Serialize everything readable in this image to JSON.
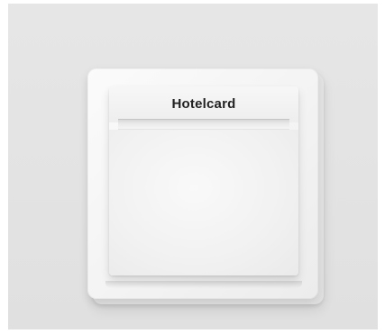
{
  "device": {
    "label": "Hotelcard"
  }
}
